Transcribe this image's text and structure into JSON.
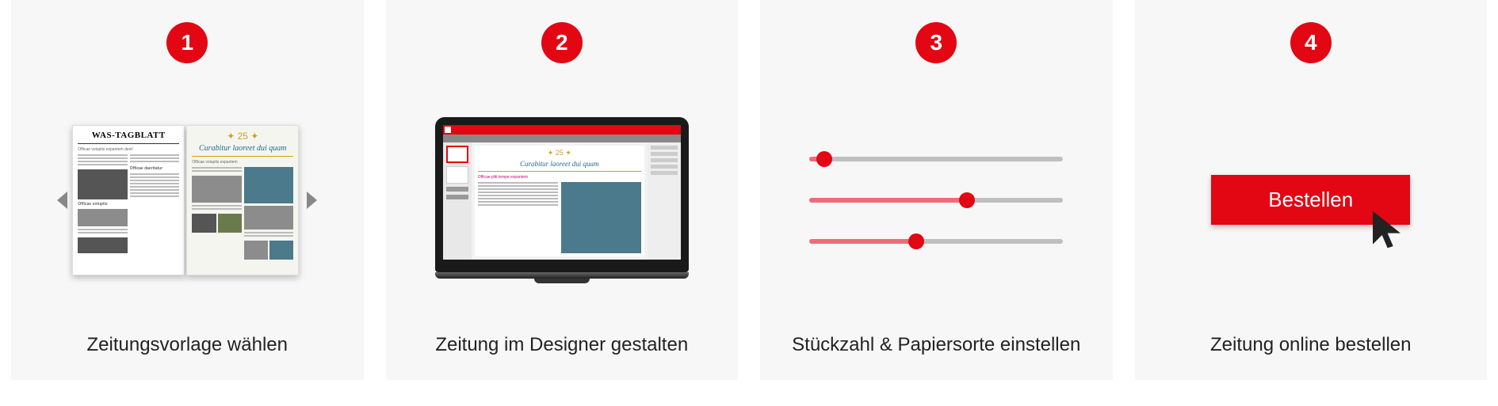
{
  "steps": [
    {
      "num": "1",
      "caption": "Zeitungsvorlage wählen",
      "newspaper_title": "WAS-TAGBLATT",
      "newspaper_script": "Curabitur laoreet dui quam"
    },
    {
      "num": "2",
      "caption": "Zeitung im Designer gestalten",
      "newspaper_script": "Curabitur laoreet dui quam"
    },
    {
      "num": "3",
      "caption": "Stückzahl & Papiersorte einstellen",
      "slider_values_percent": [
        6,
        62,
        42
      ]
    },
    {
      "num": "4",
      "caption": "Zeitung online bestellen",
      "button_label": "Bestellen"
    }
  ],
  "colors": {
    "accent": "#e30613"
  }
}
